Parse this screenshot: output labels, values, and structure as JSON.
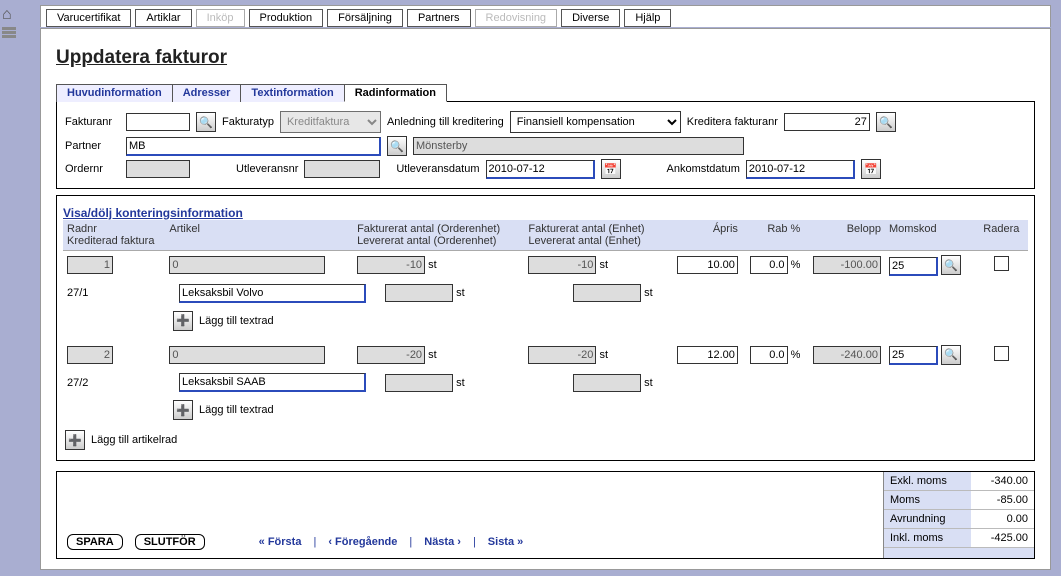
{
  "topTabs": [
    "Varucertifikat",
    "Artiklar",
    "Inköp",
    "Produktion",
    "Försäljning",
    "Partners",
    "Redovisning",
    "Diverse",
    "Hjälp"
  ],
  "topTabsDisabled": [
    2,
    6
  ],
  "pageTitle": "Uppdatera fakturor",
  "subTabs": [
    "Huvudinformation",
    "Adresser",
    "Textinformation",
    "Radinformation"
  ],
  "activeSubTab": 3,
  "labels": {
    "fakturanr": "Fakturanr",
    "fakturatyp": "Fakturatyp",
    "fakturatypValue": "Kreditfaktura",
    "anledning": "Anledning till kreditering",
    "anledningValue": "Finansiell kompensation",
    "krediteraFakturanr": "Kreditera fakturanr",
    "krediteraValue": "27",
    "partner": "Partner",
    "partnerCode": "MB",
    "partnerName": "Mönsterby",
    "ordernr": "Ordernr",
    "utleveransnr": "Utleveransnr",
    "utleveransdatum": "Utleveransdatum",
    "utlevDatumVal": "2010-07-12",
    "ankomstdatum": "Ankomstdatum",
    "ankomstVal": "2010-07-12",
    "visaDolj": "Visa/dölj konteringsinformation"
  },
  "gridHeaders": {
    "radnr1": "Radnr",
    "radnr2": "Krediterad faktura",
    "artikel": "Artikel",
    "fa1a": "Fakturerat antal (Orderenhet)",
    "fa1b": "Levererat antal (Orderenhet)",
    "fa2a": "Fakturerat antal (Enhet)",
    "fa2b": "Levererat antal (Enhet)",
    "apris": "Ápris",
    "rab": "Rab %",
    "belopp": "Belopp",
    "momskod": "Momskod",
    "radera": "Radera"
  },
  "rows": [
    {
      "nr": "1",
      "kred": "27/1",
      "artCode": "0",
      "artName": "Leksaksbil Volvo",
      "fa1": "-10",
      "fa2": "-10",
      "unit": "st",
      "apris": "10.00",
      "rab": "0.0",
      "belopp": "-100.00",
      "moms": "25"
    },
    {
      "nr": "2",
      "kred": "27/2",
      "artCode": "0",
      "artName": "Leksaksbil SAAB",
      "fa1": "-20",
      "fa2": "-20",
      "unit": "st",
      "apris": "12.00",
      "rab": "0.0",
      "belopp": "-240.00",
      "moms": "25"
    }
  ],
  "texts": {
    "laggTillTextrad": "Lägg till textrad",
    "laggTillArtikelrad": "Lägg till artikelrad",
    "pct": "%"
  },
  "footer": {
    "spara": "SPARA",
    "slutfor": "SLUTFÖR",
    "first": "« Första",
    "prev": "‹ Föregående",
    "next": "Nästa ›",
    "last": "Sista »"
  },
  "totals": {
    "exkl": "Exkl. moms",
    "exklV": "-340.00",
    "moms": "Moms",
    "momsV": "-85.00",
    "avr": "Avrundning",
    "avrV": "0.00",
    "inkl": "Inkl. moms",
    "inklV": "-425.00"
  }
}
